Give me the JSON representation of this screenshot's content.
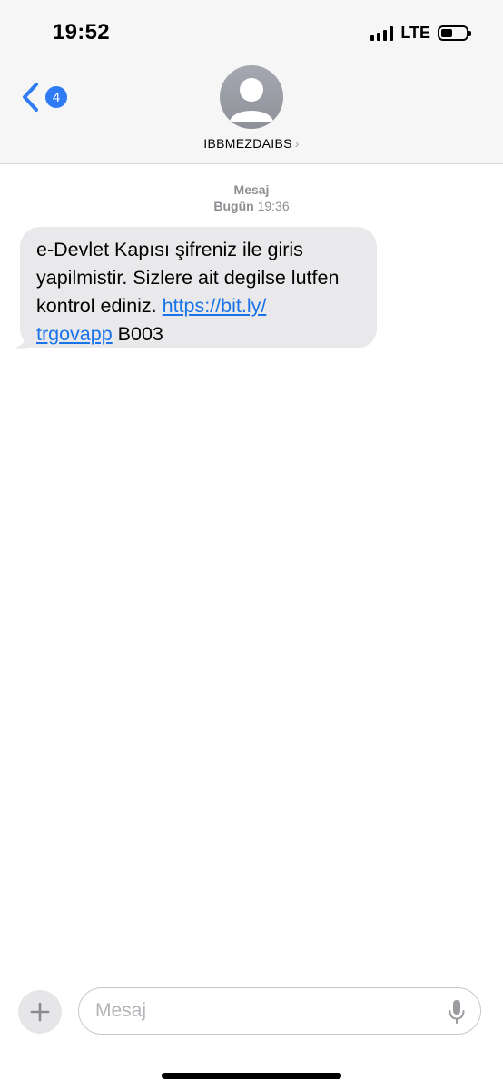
{
  "status_bar": {
    "time": "19:52",
    "network": "LTE",
    "battery_level": 0.45
  },
  "nav": {
    "back_badge": "4",
    "contact_name": "IBBMEZDAIBS",
    "contact_chevron": "›"
  },
  "thread": {
    "service_label": "Mesaj",
    "timestamp_day": "Bugün",
    "timestamp_time": "19:36"
  },
  "message": {
    "text_before_link": "e-Devlet Kapısı şifreniz ile giris yapilmistir. Sizlere ait degilse lutfen kontrol ediniz. ",
    "link_part1": "https://bit.ly/",
    "link_part2": "trgovapp",
    "text_after_link": " B003",
    "bubble_color": "#e9e9eb",
    "link_color": "#1a73e8"
  },
  "composer": {
    "placeholder": "Mesaj"
  },
  "icons": {
    "back": "chevron-left-icon",
    "avatar": "person-icon",
    "add": "plus-icon",
    "mic": "microphone-icon"
  },
  "colors": {
    "accent": "#2f7bf6",
    "header_bg": "#f6f6f6"
  }
}
